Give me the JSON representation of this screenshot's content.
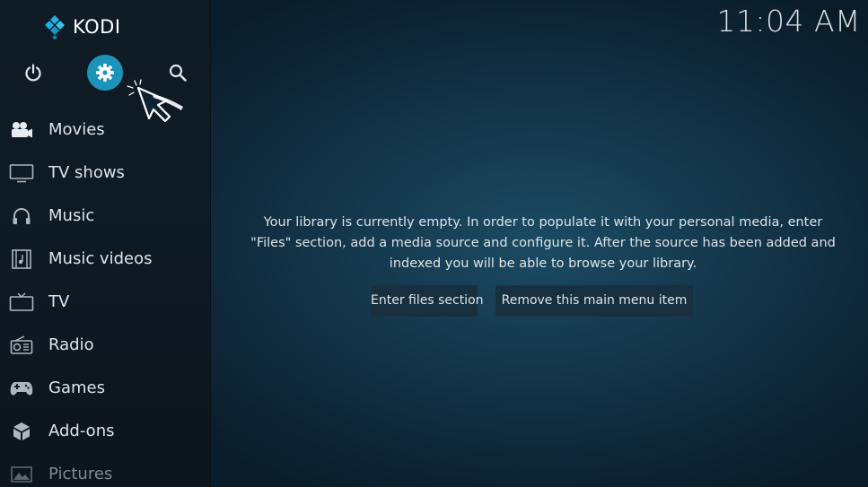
{
  "app": {
    "name": "KODI"
  },
  "clock": {
    "time": "11:04 AM"
  },
  "top_icons": {
    "power": "power-icon",
    "settings": "gear-icon",
    "search": "search-icon"
  },
  "sidebar": {
    "items": [
      {
        "label": "Movies",
        "icon": "movies-icon"
      },
      {
        "label": "TV shows",
        "icon": "tv-shows-icon"
      },
      {
        "label": "Music",
        "icon": "headphones-icon"
      },
      {
        "label": "Music videos",
        "icon": "music-videos-icon"
      },
      {
        "label": "TV",
        "icon": "tv-icon"
      },
      {
        "label": "Radio",
        "icon": "radio-icon"
      },
      {
        "label": "Games",
        "icon": "gamepad-icon"
      },
      {
        "label": "Add-ons",
        "icon": "addons-icon"
      },
      {
        "label": "Pictures",
        "icon": "pictures-icon"
      }
    ]
  },
  "main": {
    "message_line1": "Your library is currently empty. In order to populate it with your personal media, enter",
    "message_line2": "\"Files\" section, add a media source and configure it. After the source has been added and",
    "message_line3": "indexed you will be able to browse your library.",
    "enter_files_label": "Enter files section",
    "remove_item_label": "Remove this main menu item"
  },
  "colors": {
    "accent": "#1c93b9",
    "sidebar_bg": "#0f1b25",
    "main_bg": "#15384d",
    "button_bg": "#18303e"
  }
}
